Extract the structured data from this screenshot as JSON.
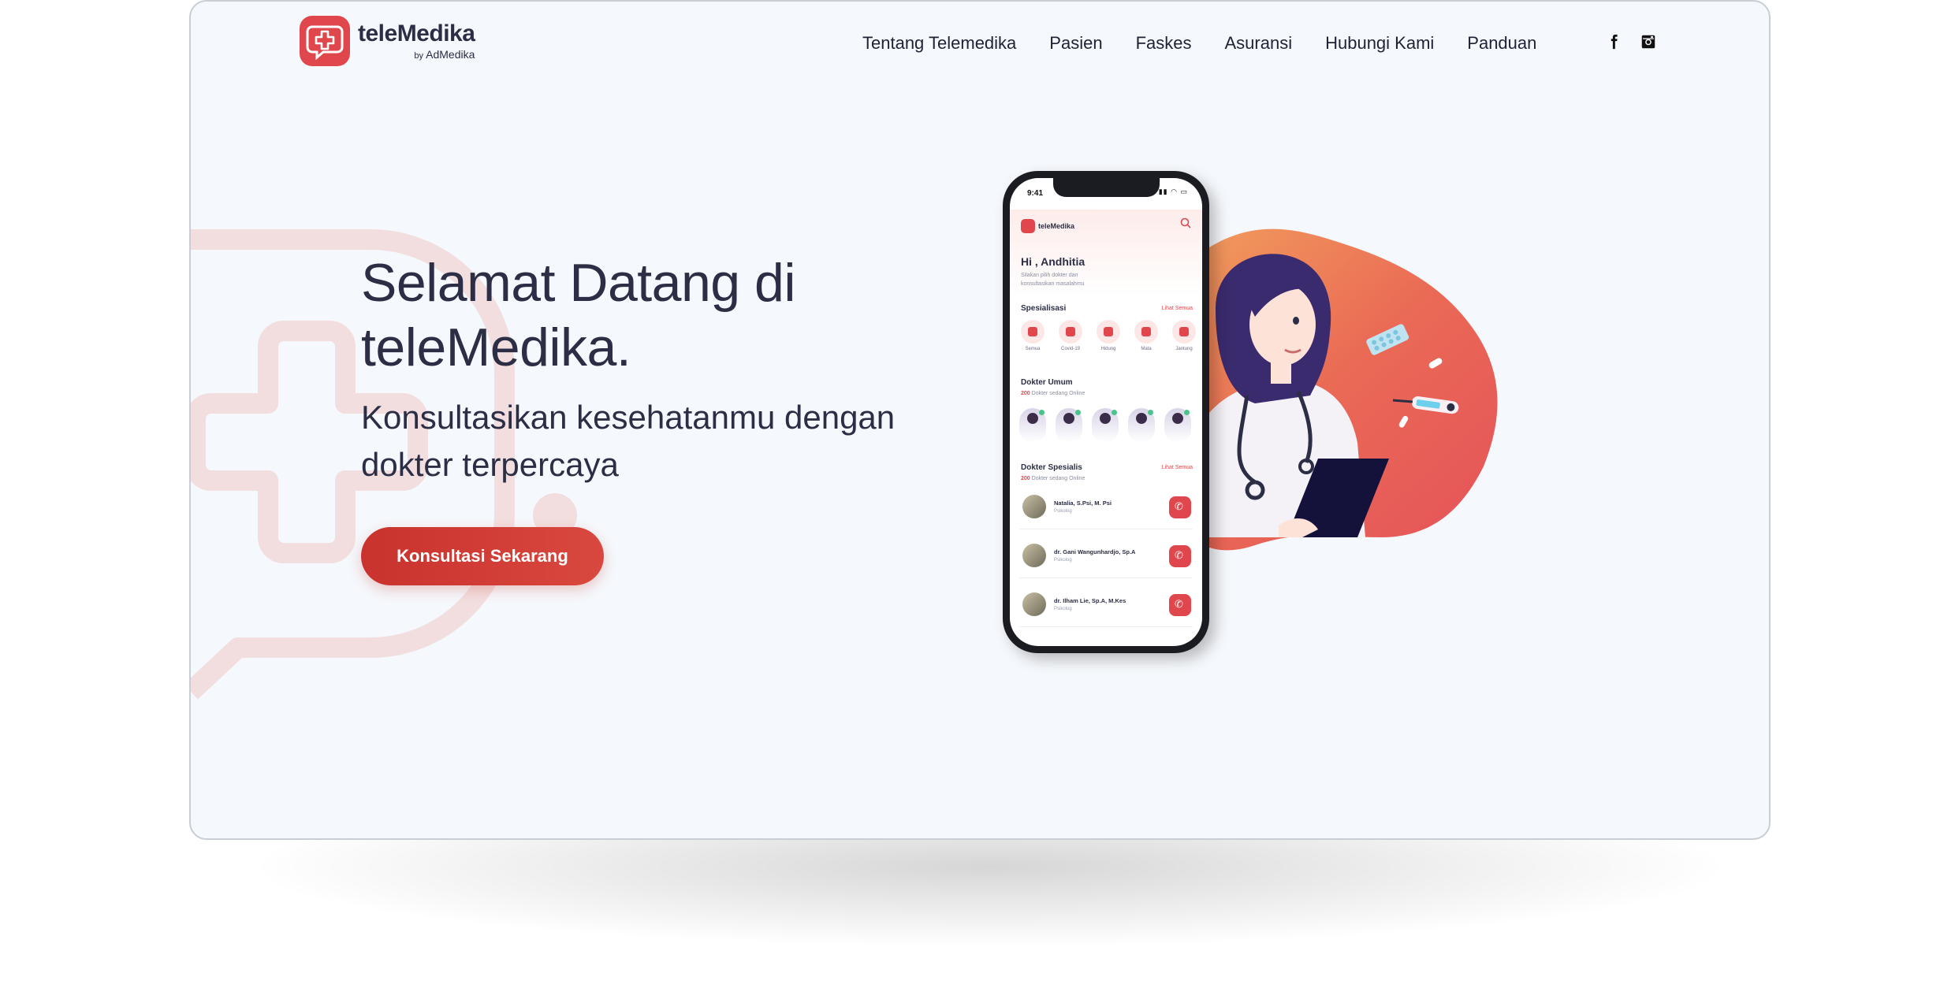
{
  "brand": {
    "name": "teleMedika",
    "by": "by",
    "owner": "AdMedika",
    "accent_color": "#e0474c",
    "text_color": "#2b2e45"
  },
  "nav": {
    "items": [
      "Tentang Telemedika",
      "Pasien",
      "Faskes",
      "Asuransi",
      "Hubungi Kami",
      "Panduan"
    ]
  },
  "social": {
    "icons": [
      "facebook-icon",
      "instagram-icon"
    ]
  },
  "hero": {
    "title_line1": "Selamat Datang di",
    "title_line2": "teleMedika.",
    "subtitle_line1": "Konsultasikan kesehatanmu dengan",
    "subtitle_line2": "dokter terpercaya",
    "cta_label": "Konsultasi Sekarang"
  },
  "phone": {
    "time": "9:41",
    "app_name": "teleMedika",
    "greeting": "Hi , Andhitia",
    "greeting_sub": "Silakan pilih dokter dan konsultasikan masalahmu",
    "specialization_title": "Spesialisasi",
    "see_all": "Lihat Semua",
    "categories": [
      "Semua",
      "Covid-19",
      "Hidung",
      "Mata",
      "Jantung"
    ],
    "general_title": "Dokter Umum",
    "general_online_count": "200",
    "general_online_text": "Dokter sedang Online",
    "specialist_title": "Dokter Spesialis",
    "specialist_online_count": "200",
    "specialist_online_text": "Dokter sedang Online",
    "specialists": [
      {
        "name": "Natalia, S.Psi, M. Psi",
        "role": "Psikolog"
      },
      {
        "name": "dr. Gani Wangunhardjo, Sp.A",
        "role": "Psikolog"
      },
      {
        "name": "dr. Ilham Lie, Sp.A, M.Kes",
        "role": "Psikolog"
      }
    ]
  }
}
